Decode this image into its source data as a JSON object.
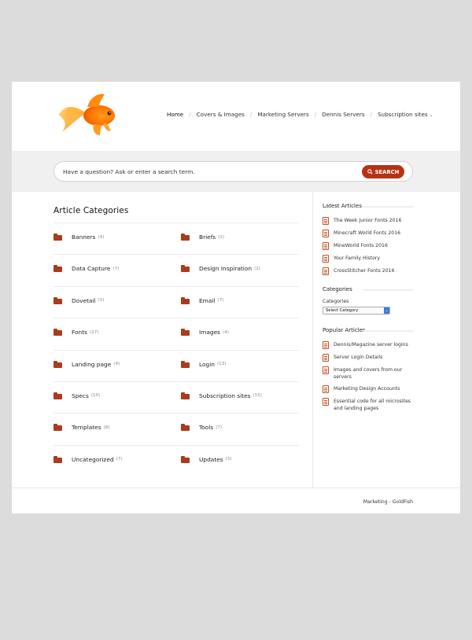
{
  "nav": {
    "items": [
      "Home",
      "Covers & Images",
      "Marketing Servers",
      "Dennis Servers",
      "Subscription sites"
    ],
    "separator": "/"
  },
  "search": {
    "placeholder": "Have a question? Ask or enter a search term.",
    "button_label": "SEARCH"
  },
  "main": {
    "title": "Article Categories",
    "categories": [
      {
        "name": "Banners",
        "count": "(4)"
      },
      {
        "name": "Briefs",
        "count": "(2)"
      },
      {
        "name": "Data Capture",
        "count": "(7)"
      },
      {
        "name": "Design Inspiration",
        "count": "(2)"
      },
      {
        "name": "Dovetail",
        "count": "(5)"
      },
      {
        "name": "Email",
        "count": "(7)"
      },
      {
        "name": "Fonts",
        "count": "(27)"
      },
      {
        "name": "Images",
        "count": "(4)"
      },
      {
        "name": "Landing page",
        "count": "(4)"
      },
      {
        "name": "Login",
        "count": "(13)"
      },
      {
        "name": "Specs",
        "count": "(10)"
      },
      {
        "name": "Subscription sites",
        "count": "(15)"
      },
      {
        "name": "Templates",
        "count": "(8)"
      },
      {
        "name": "Tools",
        "count": "(7)"
      },
      {
        "name": "Uncategorized",
        "count": "(7)"
      },
      {
        "name": "Updates",
        "count": "(3)"
      }
    ]
  },
  "sidebar": {
    "latest_title": "Latest Articles",
    "latest": [
      "The Week Junior Fonts 2016",
      "Minecraft World Fonts 2016",
      "MineWorld Fonts 2016",
      "Your Family History",
      "CrossStitcher Fonts 2016"
    ],
    "categories_title": "Categories",
    "categories_label": "Categories",
    "categories_select": "Select Category",
    "popular_title": "Popular Articles",
    "popular": [
      "Dennis/Magazine server logins",
      "Server Login Details",
      "Images and covers from our servers",
      "Marketing Design Accounts",
      "Essential code for all microsites and landing pages"
    ]
  },
  "footer": {
    "text": "Marketing - GoldFish"
  },
  "colors": {
    "accent": "#b53214",
    "folder": "#a93c1c",
    "page_bg": "#dcdcdc"
  }
}
